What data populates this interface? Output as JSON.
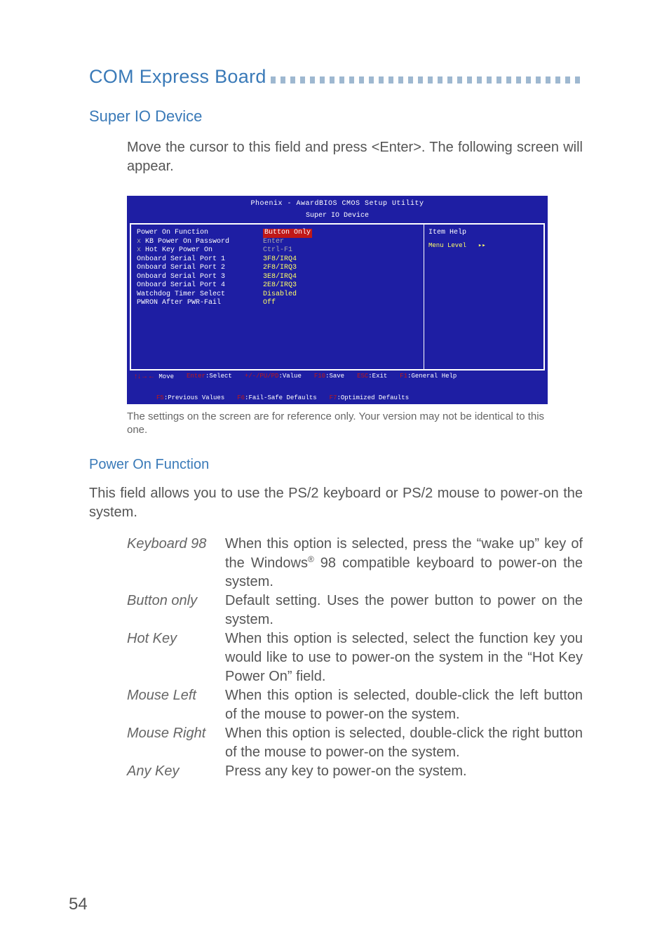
{
  "header": {
    "title": "COM Express Board"
  },
  "section1": {
    "heading": "Super IO Device",
    "intro": "Move the cursor to this field and press <Enter>. The following screen will appear."
  },
  "bios": {
    "title": "Phoenix - AwardBIOS CMOS Setup Utility",
    "subtitle": "Super IO Device",
    "rows": [
      {
        "label": "Power On Function",
        "value": "Button Only",
        "hl": true
      },
      {
        "label": "KB Power On Password",
        "value": "Enter",
        "x": true
      },
      {
        "label": "Hot Key Power On",
        "value": "Ctrl-F1",
        "x": true
      },
      {
        "label": "Onboard Serial Port 1",
        "value": "3F8/IRQ4"
      },
      {
        "label": "Onboard Serial Port 2",
        "value": "2F8/IRQ3"
      },
      {
        "label": "Onboard Serial Port 3",
        "value": "3E8/IRQ4"
      },
      {
        "label": "Onboard Serial Port 4",
        "value": "2E8/IRQ3"
      },
      {
        "label": "Watchdog Timer Select",
        "value": "Disabled"
      },
      {
        "label": "PWRON After PWR-Fail",
        "value": "Off"
      }
    ],
    "help_title": "Item Help",
    "help_level": "Menu Level",
    "footer": [
      {
        "k": "arrows",
        "t": "Move"
      },
      {
        "k": "Enter",
        "t": ":Select"
      },
      {
        "k": "+/-/PU/PD",
        "t": ":Value"
      },
      {
        "k": "F10",
        "t": ":Save"
      },
      {
        "k": "ESC",
        "t": ":Exit"
      },
      {
        "k": "F1",
        "t": ":General Help"
      },
      {
        "k": "F5",
        "t": ":Previous Values"
      },
      {
        "k": "F6",
        "t": ":Fail-Safe Defaults"
      },
      {
        "k": "F7",
        "t": ":Optimized Defaults"
      }
    ]
  },
  "caption": "The settings on the screen are for reference only. Your version may not be identical to this one.",
  "section2": {
    "heading": "Power On Function",
    "intro": "This field allows you to use the PS/2 keyboard or PS/2 mouse to power-on the system.",
    "options": [
      {
        "term": "Keyboard 98",
        "desc_a": "When this option is selected, press the “wake up” key of the Windows",
        "desc_b": " 98 compatible keyboard to power-on the system.",
        "sup": "®"
      },
      {
        "term": "Button only",
        "desc": "Default setting. Uses the power button to power on the system."
      },
      {
        "term": "Hot Key",
        "desc": "When this option is selected, select the function key you would like to use to power-on the system in the “Hot Key Power On” field."
      },
      {
        "term": "Mouse Left",
        "desc": "When this option is selected, double-click the left button of the mouse to power-on the system."
      },
      {
        "term": "Mouse Right",
        "desc": "When this option is selected, double-click the right button of the mouse to power-on the system."
      },
      {
        "term": "Any Key",
        "desc": "Press any key to power-on the system."
      }
    ]
  },
  "page_number": "54"
}
